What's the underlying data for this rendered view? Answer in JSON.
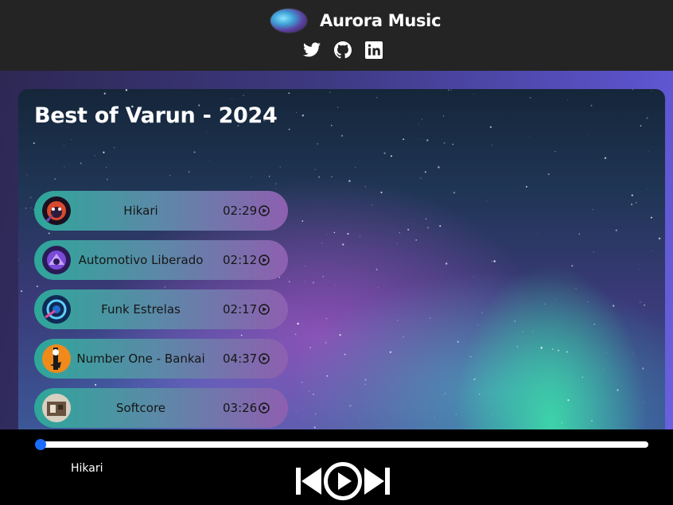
{
  "header": {
    "app_title": "Aurora Music",
    "logo_icon": "aurora-logo-icon",
    "social_links": [
      {
        "name": "twitter",
        "icon": "twitter-icon"
      },
      {
        "name": "github",
        "icon": "github-icon"
      },
      {
        "name": "linkedin",
        "icon": "linkedin-icon"
      }
    ]
  },
  "playlist": {
    "title": "Best of Varun - 2024",
    "tracks": [
      {
        "name": "Hikari",
        "duration": "02:29",
        "cover_icon": "hikari-cover-icon"
      },
      {
        "name": "Automotivo Liberado",
        "duration": "02:12",
        "cover_icon": "automotivo-cover-icon"
      },
      {
        "name": "Funk Estrelas",
        "duration": "02:17",
        "cover_icon": "funk-estrelas-cover-icon"
      },
      {
        "name": "Number One - Bankai",
        "duration": "04:37",
        "cover_icon": "number-one-cover-icon"
      },
      {
        "name": "Softcore",
        "duration": "03:26",
        "cover_icon": "softcore-cover-icon"
      }
    ]
  },
  "player": {
    "now_playing": "Hikari",
    "progress": 0,
    "controls": [
      "previous-icon",
      "play-icon",
      "next-icon"
    ]
  },
  "colors": {
    "header_bg": "#242424",
    "player_bg": "#000000",
    "accent": "#1a6cff",
    "track_gradient_start": "#2ea79a",
    "track_gradient_end": "#8e5fb0"
  }
}
